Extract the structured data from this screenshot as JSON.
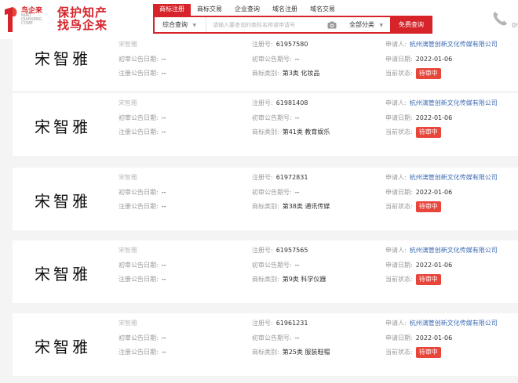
{
  "logo": {
    "brand": "鸟企来",
    "romanized_1": "NIAO",
    "romanized_2": "QIANSENG",
    "romanized_3": "COME",
    "slogan_line1": "保护知产",
    "slogan_line2": "找鸟企来",
    "mark_icon": "logo-mark-icon",
    "accent": "#d6242a"
  },
  "nav": {
    "tabs": [
      "商标注册",
      "商标交易",
      "企业查询",
      "域名注册",
      "域名交易"
    ],
    "active_index": 0
  },
  "search": {
    "scope": "综合查询",
    "placeholder": "请输入要查询的商标名称或申请号",
    "category": "全部分类",
    "button": "免费查询",
    "camera_icon": "camera-icon"
  },
  "phone": {
    "icon": "phone-icon",
    "number_fragment": "0!"
  },
  "labels": {
    "first_notice_date": "初审公告日期:",
    "reg_notice_date": "注册公告日期:",
    "reg_no": "注册号:",
    "first_notice_no": "初审公告期号:",
    "category": "商标类别:",
    "applicant": "申请人:",
    "apply_date": "申请日期:",
    "status": "当前状态:"
  },
  "results": [
    {
      "mark": "宋智雅",
      "name": "宋智雅",
      "first_notice_date": "--",
      "reg_notice_date": "--",
      "reg_no": "61957580",
      "first_notice_no": "--",
      "category": "第3类 化妆品",
      "applicant": "杭州漓管创新文化传媒有限公司",
      "apply_date": "2022-01-06",
      "status": "待审中"
    },
    {
      "mark": "宋智雅",
      "name": "宋智雅",
      "first_notice_date": "--",
      "reg_notice_date": "--",
      "reg_no": "61981408",
      "first_notice_no": "--",
      "category": "第41类 教育娱乐",
      "applicant": "杭州漓管创新文化传媒有限公司",
      "apply_date": "2022-01-06",
      "status": "待审中"
    },
    {
      "mark": "宋智雅",
      "name": "宋智雅",
      "first_notice_date": "--",
      "reg_notice_date": "--",
      "reg_no": "61972831",
      "first_notice_no": "--",
      "category": "第38类 通讯传媒",
      "applicant": "杭州漓管创新文化传媒有限公司",
      "apply_date": "2022-01-06",
      "status": "待审中"
    },
    {
      "mark": "宋智雅",
      "name": "宋智雅",
      "first_notice_date": "--",
      "reg_notice_date": "--",
      "reg_no": "61957565",
      "first_notice_no": "--",
      "category": "第9类 科学仪器",
      "applicant": "杭州漓管创新文化传媒有限公司",
      "apply_date": "2022-01-06",
      "status": "待审中"
    },
    {
      "mark": "宋智雅",
      "name": "宋智雅",
      "first_notice_date": "--",
      "reg_notice_date": "--",
      "reg_no": "61961231",
      "first_notice_no": "--",
      "category": "第25类 服装鞋帽",
      "applicant": "杭州漓管创新文化传媒有限公司",
      "apply_date": "2022-01-06",
      "status": "待审中"
    }
  ]
}
